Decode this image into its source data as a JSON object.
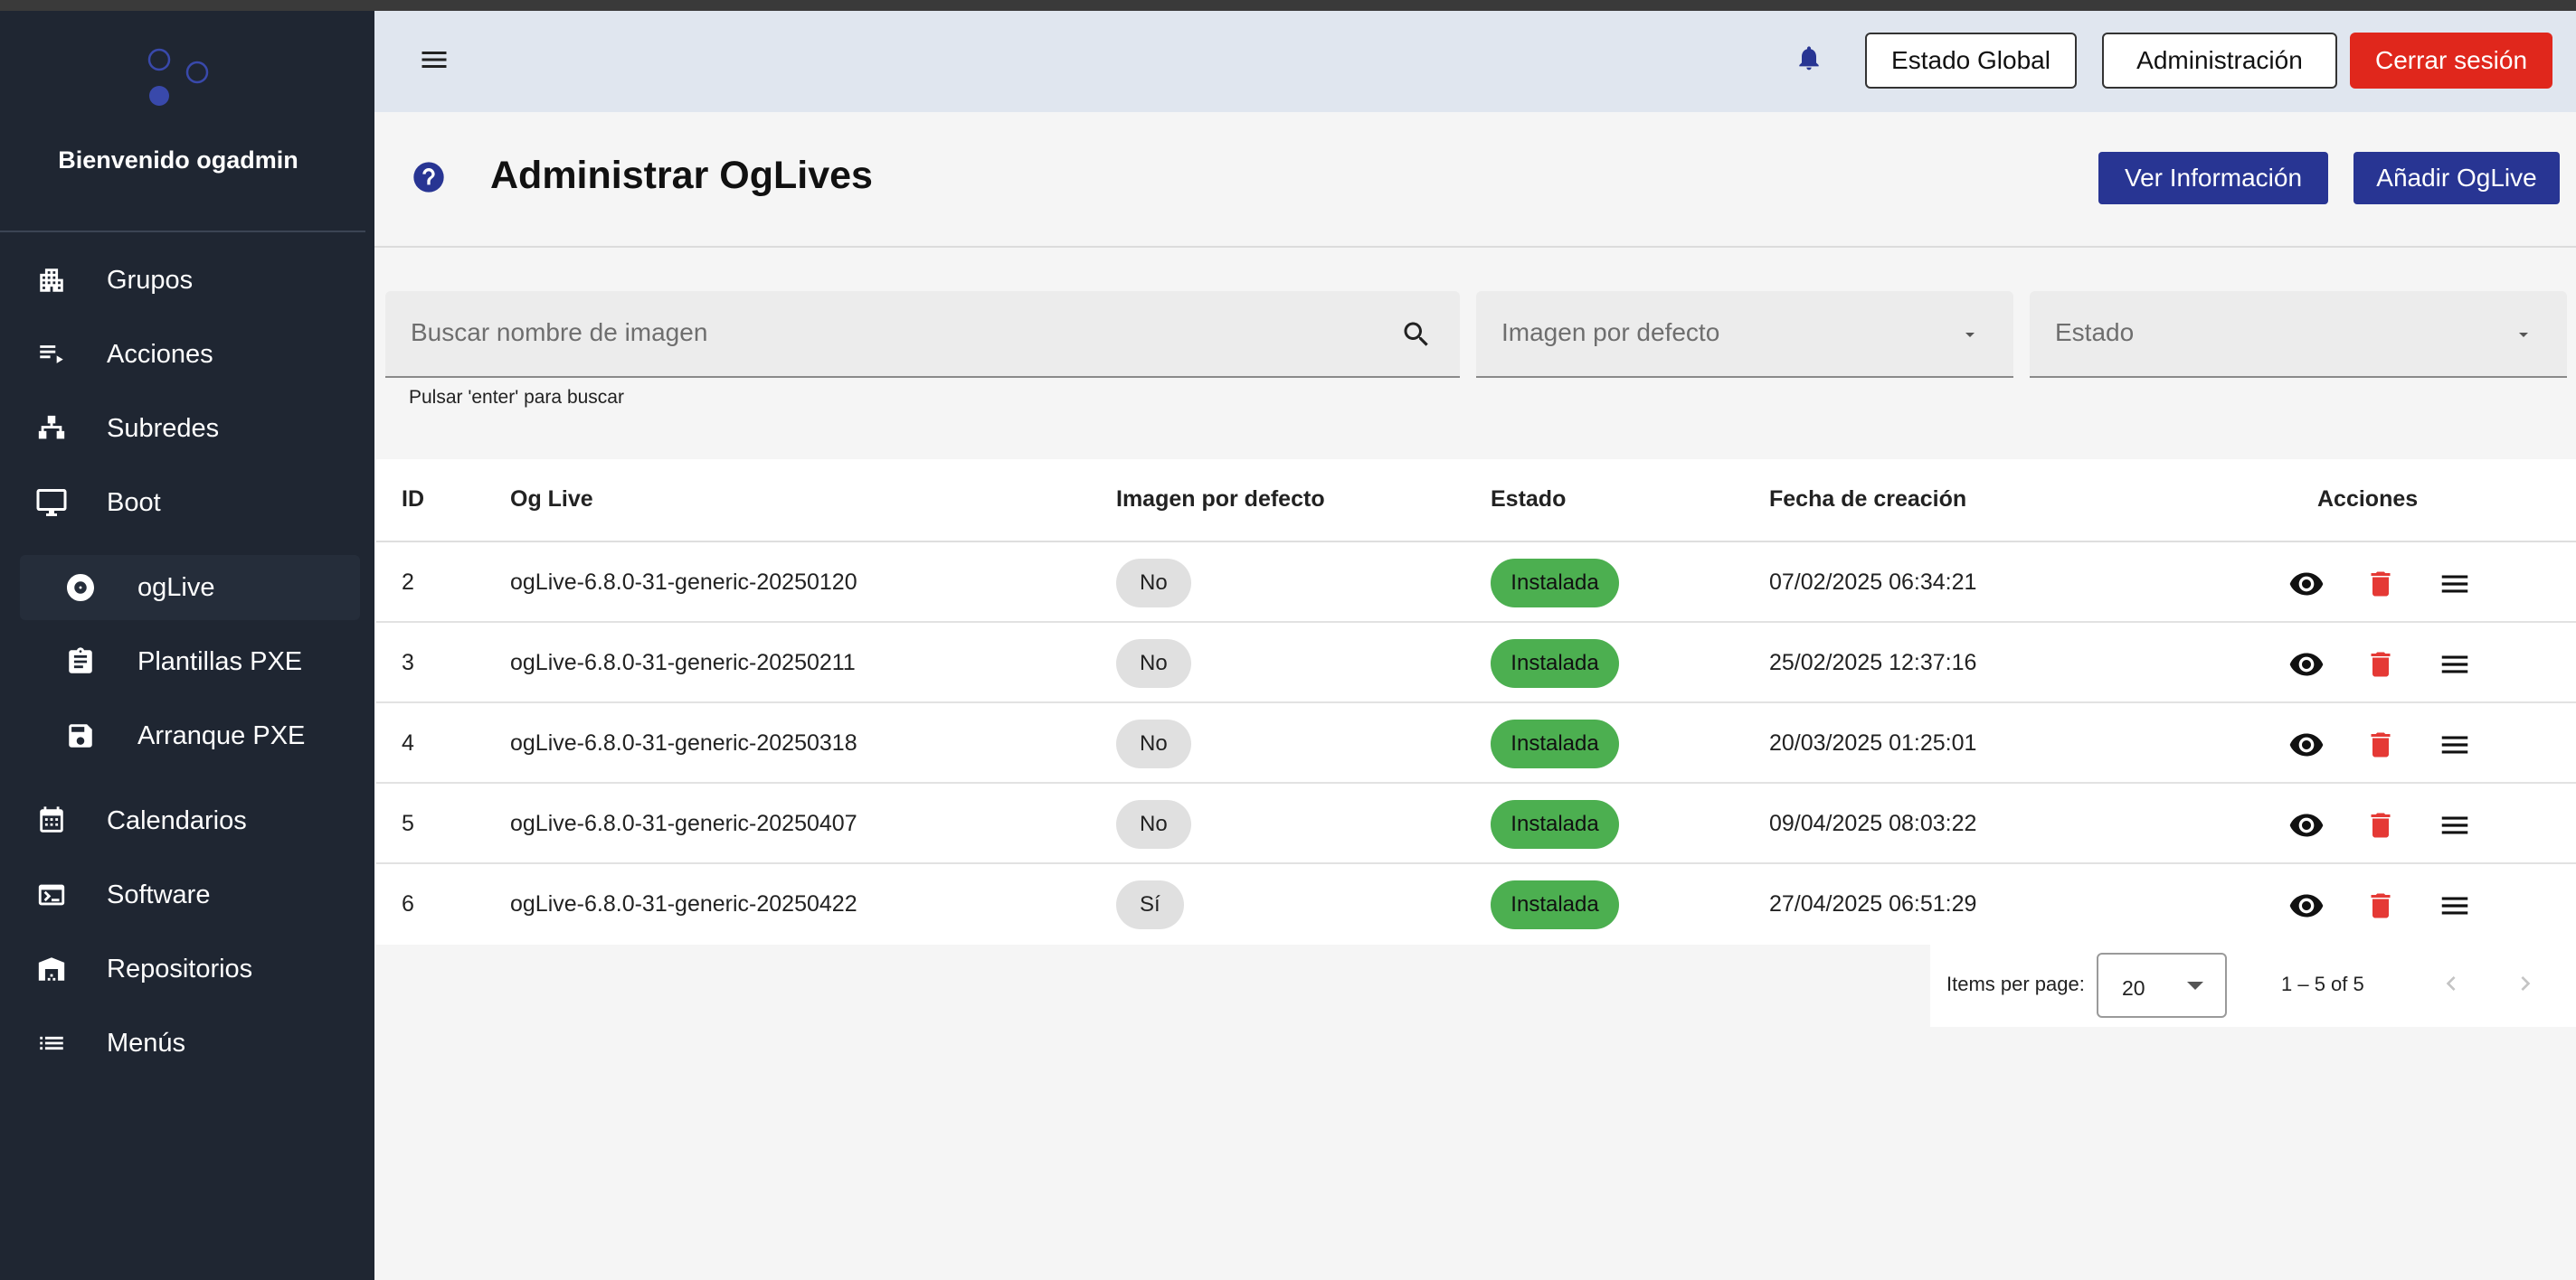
{
  "sidebar": {
    "welcome": "Bienvenido ogadmin",
    "items": [
      {
        "label": "Grupos",
        "icon": "groups-building-icon"
      },
      {
        "label": "Acciones",
        "icon": "actions-list-icon"
      },
      {
        "label": "Subredes",
        "icon": "subnets-hierarchy-icon"
      },
      {
        "label": "Boot",
        "icon": "monitor-icon"
      },
      {
        "label": "ogLive",
        "icon": "disc-icon",
        "active": true
      },
      {
        "label": "Plantillas PXE",
        "icon": "clipboard-icon"
      },
      {
        "label": "Arranque PXE",
        "icon": "floppy-save-icon"
      },
      {
        "label": "Calendarios",
        "icon": "calendar-icon"
      },
      {
        "label": "Software",
        "icon": "terminal-icon"
      },
      {
        "label": "Repositorios",
        "icon": "warehouse-icon"
      },
      {
        "label": "Menús",
        "icon": "menu-list-icon"
      }
    ]
  },
  "header": {
    "estado_global": "Estado Global",
    "administracion": "Administración",
    "cerrar_sesion": "Cerrar sesión"
  },
  "page": {
    "title": "Administrar OgLives",
    "ver_informacion": "Ver Información",
    "anadir_oglive": "Añadir OgLive"
  },
  "filters": {
    "search_placeholder": "Buscar nombre de imagen",
    "search_hint": "Pulsar 'enter' para buscar",
    "default_image_placeholder": "Imagen por defecto",
    "status_placeholder": "Estado"
  },
  "table": {
    "columns": [
      "ID",
      "Og Live",
      "Imagen por defecto",
      "Estado",
      "Fecha de creación",
      "Acciones"
    ],
    "rows": [
      {
        "id": "2",
        "oglive": "ogLive-6.8.0-31-generic-20250120",
        "default": "No",
        "status": "Instalada",
        "created": "07/02/2025 06:34:21"
      },
      {
        "id": "3",
        "oglive": "ogLive-6.8.0-31-generic-20250211",
        "default": "No",
        "status": "Instalada",
        "created": "25/02/2025 12:37:16"
      },
      {
        "id": "4",
        "oglive": "ogLive-6.8.0-31-generic-20250318",
        "default": "No",
        "status": "Instalada",
        "created": "20/03/2025 01:25:01"
      },
      {
        "id": "5",
        "oglive": "ogLive-6.8.0-31-generic-20250407",
        "default": "No",
        "status": "Instalada",
        "created": "09/04/2025 08:03:22"
      },
      {
        "id": "6",
        "oglive": "ogLive-6.8.0-31-generic-20250422",
        "default": "Sí",
        "status": "Instalada",
        "created": "27/04/2025 06:51:29"
      }
    ]
  },
  "paginator": {
    "items_per_page_label": "Items per page:",
    "items_per_page": "20",
    "range": "1 – 5 of 5"
  },
  "colors": {
    "sidebar_bg": "#1f2632",
    "header_bg": "#e0e6ef",
    "primary": "#283593",
    "danger": "#e0271c",
    "status_green": "#4caf50",
    "delete_red": "#e53935"
  }
}
